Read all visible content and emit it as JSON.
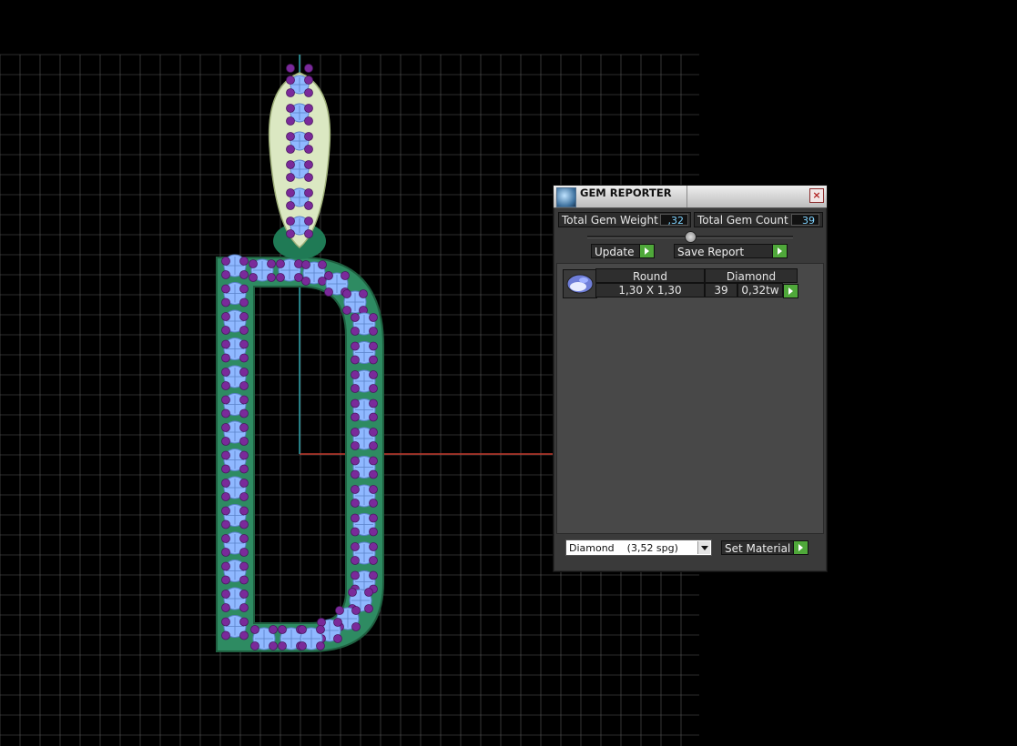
{
  "panel": {
    "title": "GEM REPORTER",
    "close_glyph": "×",
    "total_weight_label": "Total Gem Weight",
    "total_weight_value": ",32",
    "total_count_label": "Total Gem Count",
    "total_count_value": "39",
    "update_label": "Update",
    "save_report_label": "Save Report",
    "table": {
      "columns": [
        "Round",
        "Diamond"
      ],
      "row": {
        "size": "1,30 X 1,30",
        "count": "39",
        "weight": "0,32tw"
      }
    },
    "material_select": "Diamond    (3,52 spg)",
    "set_material_label": "Set Material"
  },
  "icons": {
    "title": "gem-reporter-icon",
    "close": "close-icon",
    "gem": "round-gem-icon",
    "arrows": "play-arrow-icon",
    "dropdown": "chevron-down-icon"
  },
  "colors": {
    "background": "#000000",
    "grid": "#5a5a5a",
    "x_axis": "#c0392b",
    "y_axis": "#2aa0a8",
    "metal": "#2e8b62",
    "gem_body": "#8fb8ff",
    "prong": "#7a2a9a",
    "bail": "#dbe8c2"
  }
}
